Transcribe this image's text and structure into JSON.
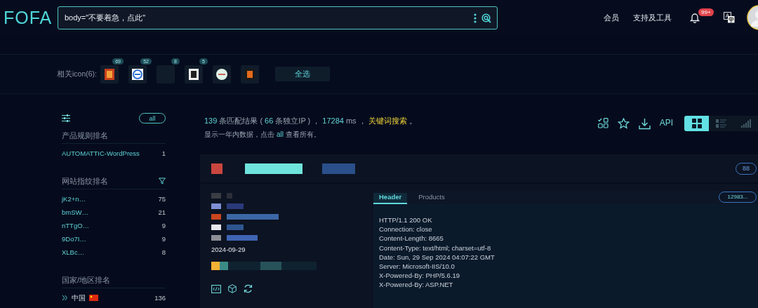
{
  "header": {
    "logo": "FOFA",
    "search": {
      "value": "body=\"不要着急，点此\""
    },
    "nav": [
      {
        "label": "会员"
      },
      {
        "label": "支持及工具"
      }
    ],
    "notification_badge": "99+"
  },
  "related_icons": {
    "label": "相关icon(6):",
    "icons": [
      {
        "kind": "counted",
        "count": "69"
      },
      {
        "kind": "counted",
        "count": "52"
      },
      {
        "kind": "counted",
        "count": "8"
      },
      {
        "kind": "counted",
        "count": "5"
      },
      {
        "kind": "plain"
      },
      {
        "kind": "plain"
      }
    ],
    "select_all": "全选"
  },
  "sidebar": {
    "all_label": "all",
    "sections": [
      {
        "title": "产品规则排名",
        "kind": "plain",
        "has_filter": false,
        "items": [
          {
            "name": "AUTOMATTIC-WordPress",
            "count": "1"
          }
        ]
      },
      {
        "title": "网站指纹排名",
        "kind": "plain",
        "has_filter": true,
        "items": [
          {
            "name": "jK2+n…",
            "count": "75"
          },
          {
            "name": "bmSW…",
            "count": "21"
          },
          {
            "name": "nTTgO…",
            "count": "9"
          },
          {
            "name": "9Do7I…",
            "count": "9"
          },
          {
            "name": "XLBc…",
            "count": "8"
          }
        ]
      },
      {
        "title": "国家/地区排名",
        "kind": "country",
        "has_filter": false,
        "items": [
          {
            "name": "中国",
            "count": "136"
          }
        ]
      }
    ]
  },
  "results": {
    "summary": [
      {
        "text": "139",
        "kind": "number"
      },
      {
        "text": "条匹配结果 (",
        "kind": "text"
      },
      {
        "text": "66",
        "kind": "number"
      },
      {
        "text": "条独立IP ) ，",
        "kind": "text"
      },
      {
        "text": "17284",
        "kind": "number"
      },
      {
        "text": "ms ，",
        "kind": "text"
      },
      {
        "text": "关键词搜索",
        "kind": "link"
      },
      {
        "text": "。",
        "kind": "text"
      }
    ],
    "note": [
      {
        "text": "显示一年内数据，点击",
        "kind": "text"
      },
      {
        "text": "all",
        "kind": "number"
      },
      {
        "text": "查看所有。",
        "kind": "text"
      }
    ],
    "api_label": "API",
    "views": [
      {
        "kind": "grid",
        "selected": true
      },
      {
        "kind": "list",
        "selected": false
      },
      {
        "kind": "chart",
        "selected": false
      }
    ]
  },
  "card": {
    "port": "88",
    "date": "2024-09-29",
    "tabs": [
      {
        "label": "Header",
        "selected": true
      },
      {
        "label": "Products",
        "selected": false
      }
    ],
    "hash": "12983...",
    "header_lines": [
      "HTTP/1.1 200 OK",
      "Connection: close",
      "Content-Length: 8665",
      "Content-Type: text/html; charset=utf-8",
      "Date: Sun, 29 Sep 2024 04:07:22 GMT",
      "Server: Microsoft-IIS/10.0",
      "X-Powered-By: PHP/5.6.19",
      "X-Powered-By: ASP.NET"
    ]
  }
}
